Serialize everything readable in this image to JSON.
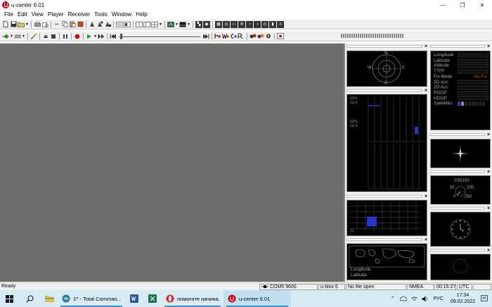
{
  "window": {
    "title": "u-center 6.01",
    "minimize_glyph": "—",
    "maximize_glyph": "❐",
    "close_glyph": "✕"
  },
  "menu": [
    "File",
    "Edit",
    "View",
    "Player",
    "Receiver",
    "Tools",
    "Window",
    "Help"
  ],
  "panels": {
    "close_glyph": "×",
    "data_fields": {
      "labels": [
        "Longitude",
        "Latitude",
        "Altitude",
        "TTFF",
        "Fix Mode",
        "3D Acc",
        "2D Acc",
        "PDOP",
        "HDOP",
        "Satellites"
      ],
      "fix_mode_value": "No Fix"
    },
    "level_labels": [
      "GPS",
      "GLO",
      "GPS",
      "GLO"
    ],
    "deviation_label": "21",
    "speed_gauge": {
      "top_value": "100|150",
      "mid_value": "50",
      "mid_value_right": "200",
      "bottom_value": "0",
      "bottom_value_right": "250"
    },
    "world_map": {
      "line1": "Longitude",
      "line2": "Latitude"
    },
    "compass_letters": {
      "n": "N",
      "e": "E",
      "s": "S",
      "w": "W"
    }
  },
  "statusbar": {
    "ready": "Ready",
    "port": "COM5 9600",
    "receiver": "u-blox 6",
    "file": "No file open",
    "protocol": "NMEA",
    "elapsed": "00:15:27",
    "timezone": "UTC"
  },
  "taskbar": {
    "apps": [
      {
        "label": "1^ - Total Comman...",
        "active": false
      },
      {
        "label": "помогите начина...",
        "active": false
      },
      {
        "label": "u-center 6.01",
        "active": true
      }
    ],
    "language": "РУС",
    "time": "17:34",
    "date": "09.02.2022"
  },
  "colors": {
    "workspace": "#6e6e6e",
    "panel_bg": "#000000",
    "accent_red": "#d0021b",
    "taskbar_bg": "#d7ecf6",
    "sat_bar": "#2a34c8"
  }
}
